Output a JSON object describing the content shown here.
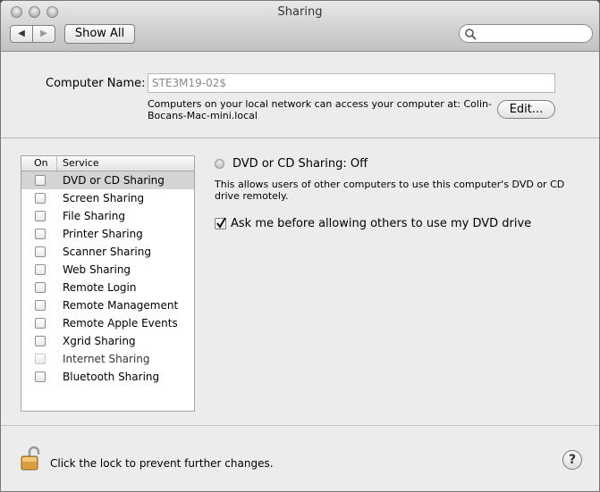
{
  "window": {
    "title": "Sharing",
    "show_all_label": "Show All",
    "back_glyph": "◀",
    "forward_glyph": "▶",
    "search_placeholder": ""
  },
  "computer_name": {
    "label": "Computer Name:",
    "value": "STE3M19-02$",
    "description": "Computers on your local network can access your computer at: Colin-Bocans-Mac-mini.local",
    "description_line1": "Computers on your local network can access your computer at: Colin-",
    "description_line2": "Bocans-Mac-mini.local",
    "edit_label": "Edit..."
  },
  "services": {
    "header_on": "On",
    "header_service": "Service",
    "items": [
      {
        "label": "DVD or CD Sharing",
        "checked": false,
        "selected": true,
        "enabled": true
      },
      {
        "label": "Screen Sharing",
        "checked": false,
        "selected": false,
        "enabled": true
      },
      {
        "label": "File Sharing",
        "checked": false,
        "selected": false,
        "enabled": true
      },
      {
        "label": "Printer Sharing",
        "checked": false,
        "selected": false,
        "enabled": true
      },
      {
        "label": "Scanner Sharing",
        "checked": false,
        "selected": false,
        "enabled": true
      },
      {
        "label": "Web Sharing",
        "checked": false,
        "selected": false,
        "enabled": true
      },
      {
        "label": "Remote Login",
        "checked": false,
        "selected": false,
        "enabled": true
      },
      {
        "label": "Remote Management",
        "checked": false,
        "selected": false,
        "enabled": true
      },
      {
        "label": "Remote Apple Events",
        "checked": false,
        "selected": false,
        "enabled": true
      },
      {
        "label": "Xgrid Sharing",
        "checked": false,
        "selected": false,
        "enabled": true
      },
      {
        "label": "Internet Sharing",
        "checked": false,
        "selected": false,
        "enabled": false
      },
      {
        "label": "Bluetooth Sharing",
        "checked": false,
        "selected": false,
        "enabled": true
      }
    ]
  },
  "detail": {
    "status_title": "DVD or CD Sharing: Off",
    "status_color": "#b5b5b5",
    "description_line1": "This allows users of other computers to use this computer's DVD or CD",
    "description_line2": "drive remotely.",
    "ask_checkbox_label": "Ask me before allowing others to use my DVD drive",
    "ask_checked": true
  },
  "footer": {
    "lock_text": "Click the lock to prevent further changes.",
    "help_glyph": "?"
  }
}
